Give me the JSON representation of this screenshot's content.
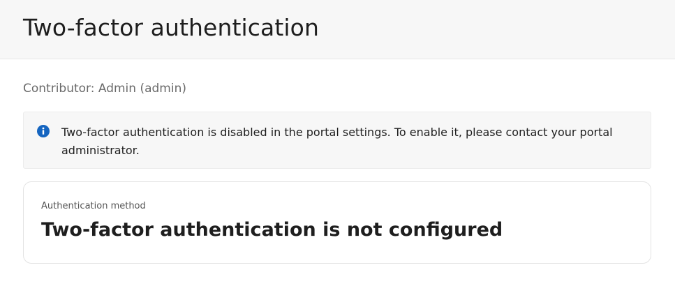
{
  "header": {
    "title": "Two-factor authentication"
  },
  "contributor": {
    "text": "Contributor: Admin (admin)"
  },
  "notice": {
    "icon": "info-icon",
    "icon_color": "#1565c0",
    "text": "Two-factor authentication is disabled in the portal settings. To enable it, please contact your portal administrator."
  },
  "auth_card": {
    "label": "Authentication method",
    "value": "Two-factor authentication is not configured"
  }
}
